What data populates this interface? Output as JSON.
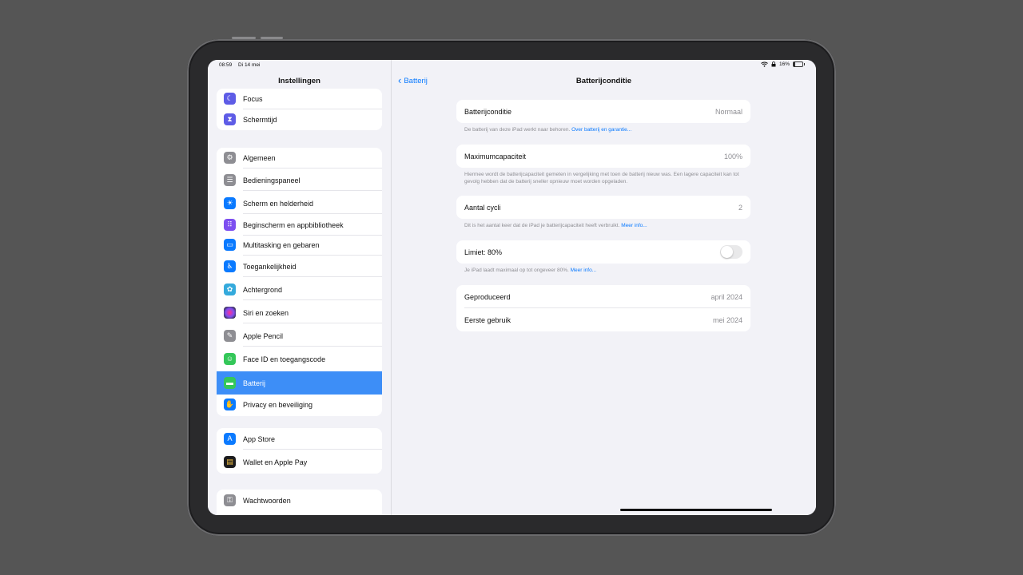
{
  "status": {
    "time": "08:59",
    "date": "Di 14 mei",
    "battery": "16%",
    "battery_level": 0.16
  },
  "sidebar": {
    "title": "Instellingen",
    "groups": [
      {
        "items": [
          {
            "label": "Focus",
            "icon": "moon-icon",
            "color": "#5e5ce6"
          },
          {
            "label": "Schermtijd",
            "icon": "hourglass-icon",
            "color": "#5e5ce6"
          }
        ]
      },
      {
        "items": [
          {
            "label": "Algemeen",
            "icon": "gear-icon",
            "color": "#8e8e93"
          },
          {
            "label": "Bedieningspaneel",
            "icon": "control-center-icon",
            "color": "#8e8e93"
          },
          {
            "label": "Scherm en helderheid",
            "icon": "sun-icon",
            "color": "#0a7aff"
          },
          {
            "label": "Beginscherm en appbibliotheek",
            "icon": "home-grid-icon",
            "color": "#7d4ff0"
          },
          {
            "label": "Multitasking en gebaren",
            "icon": "multitasking-icon",
            "color": "#0a7aff"
          },
          {
            "label": "Toegankelijkheid",
            "icon": "accessibility-icon",
            "color": "#0a7aff"
          },
          {
            "label": "Achtergrond",
            "icon": "flower-icon",
            "color": "#34aadc"
          },
          {
            "label": "Siri en zoeken",
            "icon": "siri-icon",
            "color": "#222222"
          },
          {
            "label": "Apple Pencil",
            "icon": "pencil-icon",
            "color": "#8e8e93"
          },
          {
            "label": "Face ID en toegangscode",
            "icon": "face-id-icon",
            "color": "#34c759"
          },
          {
            "label": "Batterij",
            "icon": "battery-icon",
            "color": "#34c759",
            "selected": true
          },
          {
            "label": "Privacy en beveiliging",
            "icon": "hand-icon",
            "color": "#0a7aff"
          }
        ]
      },
      {
        "items": [
          {
            "label": "App Store",
            "icon": "app-store-icon",
            "color": "#0a7aff"
          },
          {
            "label": "Wallet en Apple Pay",
            "icon": "wallet-icon",
            "color": "#1c1c1e"
          }
        ]
      },
      {
        "items": [
          {
            "label": "Wachtwoorden",
            "icon": "key-icon",
            "color": "#8e8e93"
          }
        ]
      }
    ]
  },
  "detail": {
    "back_label": "Batterij",
    "title": "Batterijconditie",
    "condition": {
      "label": "Batterijconditie",
      "value": "Normaal",
      "footer": "De batterij van deze iPad werkt naar behoren.",
      "footer_link": "Over batterij en garantie..."
    },
    "capacity": {
      "label": "Maximumcapaciteit",
      "value": "100%",
      "footer": "Hiermee wordt de batterijcapaciteit gemeten in vergelijking met toen de batterij nieuw was. Een lagere capaciteit kan tot gevolg hebben dat de batterij sneller opnieuw moet worden opgeladen."
    },
    "cycles": {
      "label": "Aantal cycli",
      "value": "2",
      "footer": "Dit is het aantal keer dat de iPad je batterijcapaciteit heeft verbruikt.",
      "footer_link": "Meer info..."
    },
    "limit": {
      "label": "Limiet: 80%",
      "enabled": false,
      "footer": "Je iPad laadt maximaal op tot ongeveer 80%.",
      "footer_link": "Meer info..."
    },
    "dates": [
      {
        "label": "Geproduceerd",
        "value": "april 2024"
      },
      {
        "label": "Eerste gebruik",
        "value": "mei 2024"
      }
    ]
  }
}
